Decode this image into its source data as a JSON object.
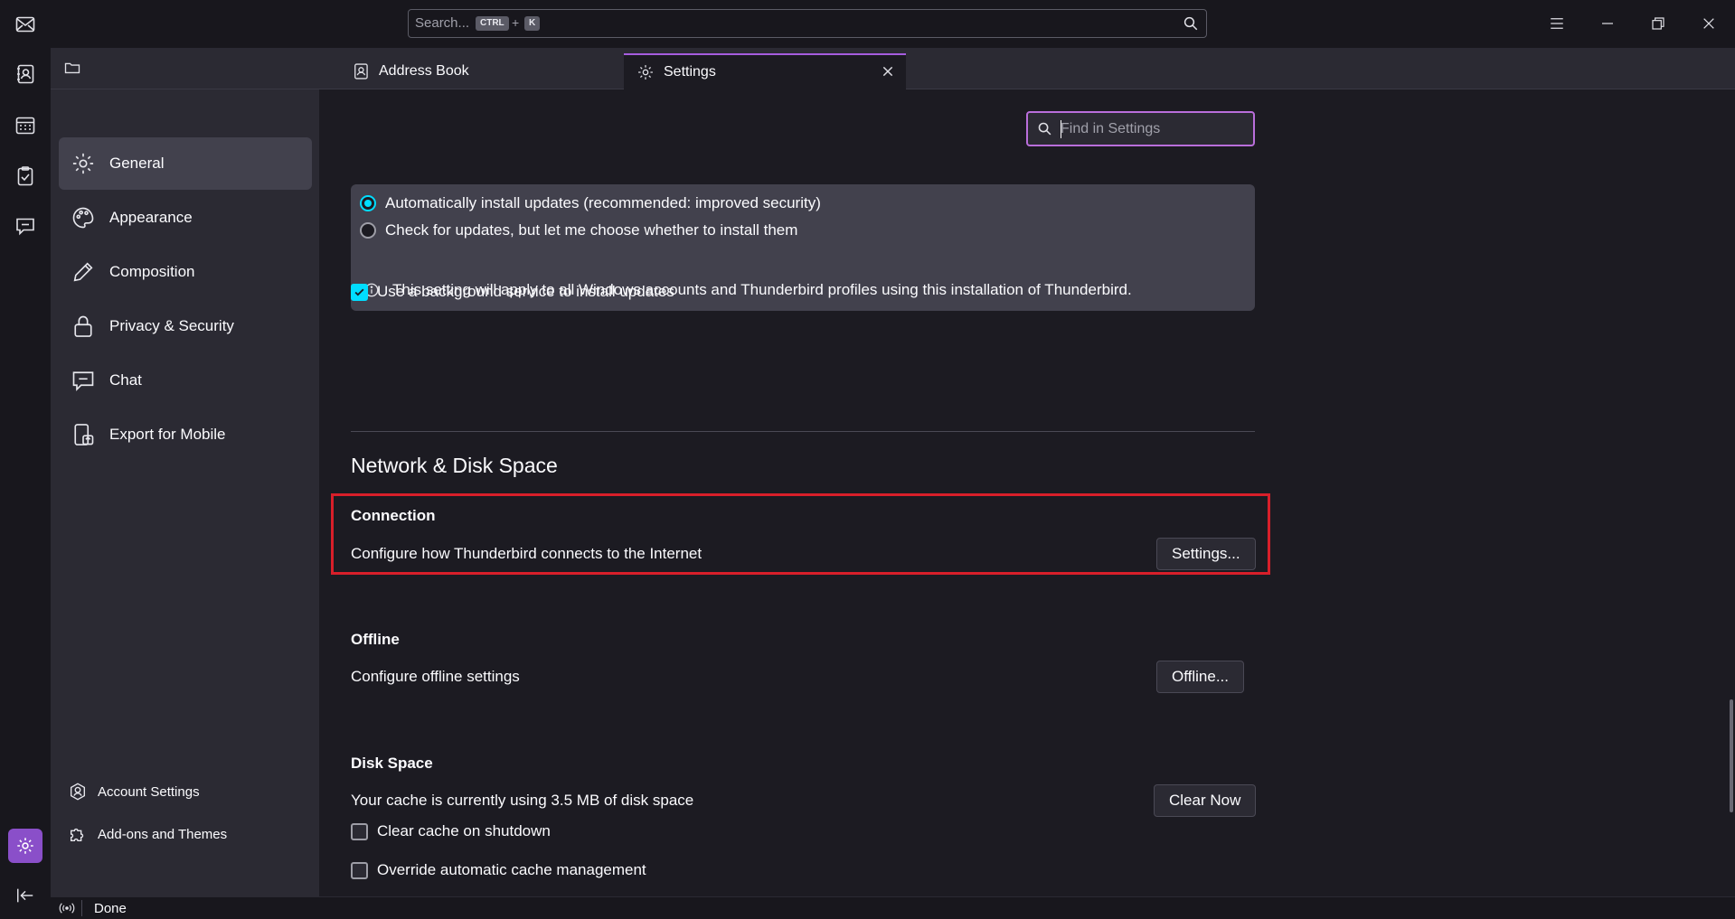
{
  "titlebar": {
    "search_placeholder": "Search...",
    "shortcut_key1": "CTRL",
    "shortcut_plus": "+",
    "shortcut_key2": "K"
  },
  "tabs": [
    {
      "label": "Address Book",
      "icon": "address-book-icon"
    },
    {
      "label": "Settings",
      "icon": "gear-icon",
      "active": true
    }
  ],
  "spaces": [
    "mail-icon",
    "address-book-icon",
    "calendar-icon",
    "tasks-icon",
    "chat-icon"
  ],
  "sidebar": {
    "categories": [
      {
        "label": "General",
        "icon": "gear-icon",
        "active": true
      },
      {
        "label": "Appearance",
        "icon": "palette-icon"
      },
      {
        "label": "Composition",
        "icon": "pencil-icon"
      },
      {
        "label": "Privacy & Security",
        "icon": "lock-icon"
      },
      {
        "label": "Chat",
        "icon": "chat-icon"
      },
      {
        "label": "Export for Mobile",
        "icon": "mobile-export-icon"
      }
    ],
    "footer": [
      {
        "label": "Account Settings",
        "icon": "account-icon"
      },
      {
        "label": "Add-ons and Themes",
        "icon": "puzzle-icon"
      }
    ]
  },
  "content": {
    "find_placeholder": "Find in Settings",
    "updates": {
      "auto_install": "Automatically install updates (recommended: improved security)",
      "check_only": "Check for updates, but let me choose whether to install them",
      "info": "This setting will apply to all Windows accounts and Thunderbird profiles using this installation of Thunderbird.",
      "background_service": "Use a background service to install updates",
      "selected": "auto_install",
      "background_checked": true
    },
    "section_title": "Network & Disk Space",
    "connection": {
      "title": "Connection",
      "desc": "Configure how Thunderbird connects to the Internet",
      "button": "Settings..."
    },
    "offline": {
      "title": "Offline",
      "desc": "Configure offline settings",
      "button": "Offline..."
    },
    "disk_space": {
      "title": "Disk Space",
      "desc": "Your cache is currently using 3.5 MB of disk space",
      "button": "Clear Now",
      "clear_on_shutdown": "Clear cache on shutdown",
      "override_cache": "Override automatic cache management"
    }
  },
  "status": {
    "text": "Done"
  },
  "colors": {
    "accent": "#00ddff",
    "highlight": "#d81f2a",
    "active_tab": "#a65ddf"
  }
}
